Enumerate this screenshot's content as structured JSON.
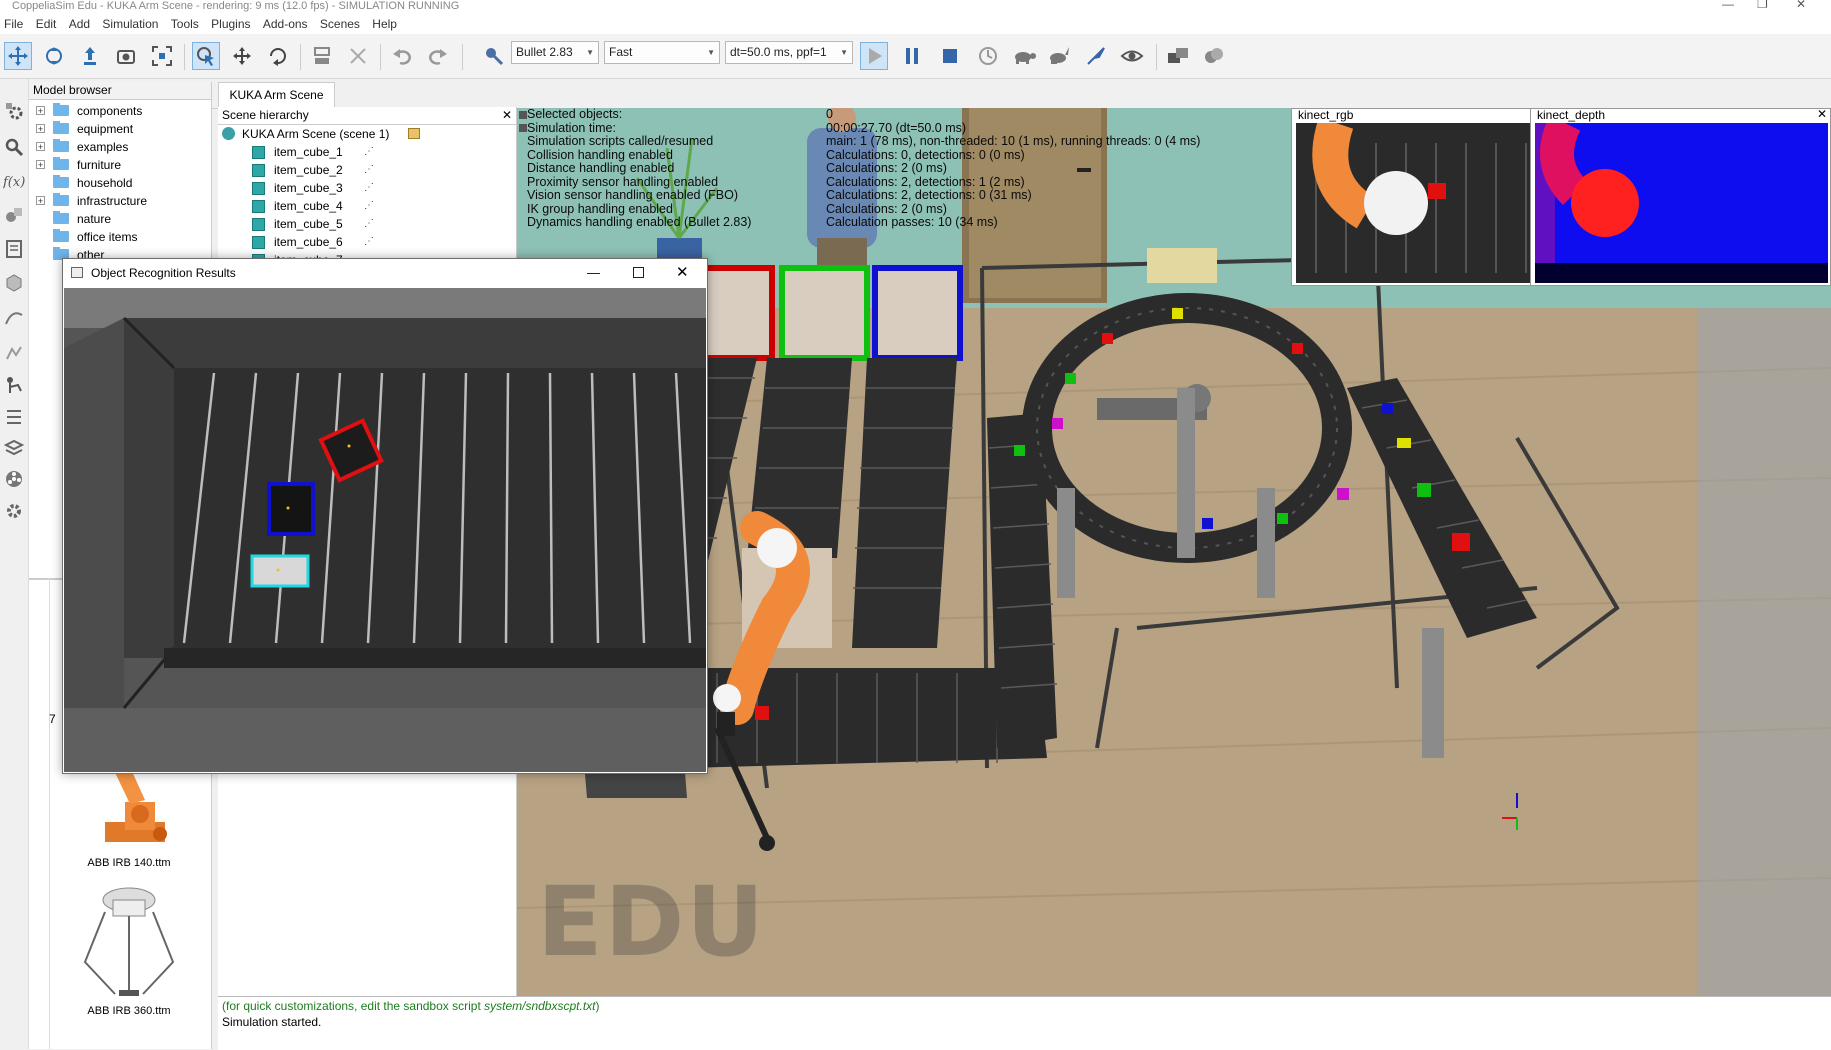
{
  "window": {
    "title": "CoppeliaSim Edu - KUKA Arm Scene - rendering: 9 ms (12.0 fps) - SIMULATION RUNNING",
    "controls": [
      "—",
      "❐",
      "✕"
    ]
  },
  "menu": [
    "File",
    "Edit",
    "Add",
    "Simulation",
    "Tools",
    "Plugins",
    "Add-ons",
    "Scenes",
    "Help"
  ],
  "toolbar": {
    "engine": "Bullet 2.83",
    "speed": "Fast",
    "timestep": "dt=50.0 ms, ppf=1"
  },
  "model_browser": {
    "header": "Model browser",
    "folders": [
      "components",
      "equipment",
      "examples",
      "furniture",
      "household",
      "infrastructure",
      "nature",
      "office items",
      "other"
    ],
    "side_number": "7",
    "thumbnails": [
      {
        "label": "ABB IRB 140.ttm"
      },
      {
        "label": "ABB IRB 360.ttm"
      }
    ]
  },
  "scene": {
    "tab": "KUKA Arm Scene",
    "hierarchy_header": "Scene hierarchy",
    "root": "KUKA Arm Scene (scene 1)",
    "items": [
      "item_cube_1",
      "item_cube_2",
      "item_cube_3",
      "item_cube_4",
      "item_cube_5",
      "item_cube_6",
      "item_cube_7"
    ]
  },
  "overlay": {
    "labels": [
      "Selected objects:",
      "Simulation time:",
      "Simulation scripts called/resumed",
      "Collision handling enabled",
      "Distance handling enabled",
      "Proximity sensor handling enabled",
      "Vision sensor handling enabled (FBO)",
      "IK group handling enabled",
      "Dynamics handling enabled (Bullet 2.83)"
    ],
    "values": [
      "0",
      "00:00:27.70 (dt=50.0 ms)",
      "main: 1 (78 ms), non-threaded: 10 (1 ms), running threads: 0 (4 ms)",
      "Calculations: 0, detections: 0 (0 ms)",
      "Calculations: 2 (0 ms)",
      "Calculations: 2, detections: 1 (2 ms)",
      "Calculations: 2, detections: 0 (31 ms)",
      "Calculations: 2 (0 ms)",
      "Calculation passes: 10 (34 ms)"
    ]
  },
  "floating_view": {
    "title": "Object Recognition Results"
  },
  "subviews": [
    {
      "title": "kinect_rgb"
    },
    {
      "title": "kinect_depth"
    }
  ],
  "watermark": "EDU",
  "console": {
    "line1_prefix": "(for quick customizations, edit the sandbox script ",
    "line1_script": "system/sndbxscpt.txt",
    "line1_suffix": ")",
    "line2": "Simulation started."
  },
  "colors": {
    "accent": "#cfe4f7",
    "console_green": "#1d7d1d",
    "cube_teal": "#2ea7a7",
    "red": "#e01010",
    "green": "#10c010",
    "blue": "#1010d0"
  }
}
